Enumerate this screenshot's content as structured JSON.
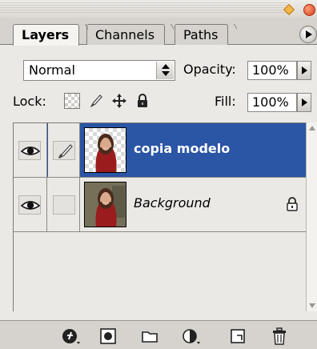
{
  "tabs": [
    {
      "label": "Layers",
      "active": true
    },
    {
      "label": "Channels",
      "active": false
    },
    {
      "label": "Paths",
      "active": false
    }
  ],
  "blend_mode": {
    "value": "Normal"
  },
  "opacity": {
    "label": "Opacity:",
    "value": "100%"
  },
  "lock": {
    "label": "Lock:"
  },
  "fill": {
    "label": "Fill:",
    "value": "100%"
  },
  "layers": [
    {
      "name": "copia modelo",
      "selected": true,
      "visible": true,
      "transparent_thumb": true
    },
    {
      "name": "Background",
      "selected": false,
      "visible": true,
      "locked": true
    }
  ],
  "colors": {
    "selection": "#2b55a5",
    "panel": "#d6d3ce",
    "content": "#ebe9e5"
  },
  "bottom_toolbar": {
    "icons": [
      "layer-style-icon",
      "add-mask-icon",
      "new-group-icon",
      "adjustment-layer-icon",
      "new-layer-icon",
      "trash-icon"
    ]
  }
}
